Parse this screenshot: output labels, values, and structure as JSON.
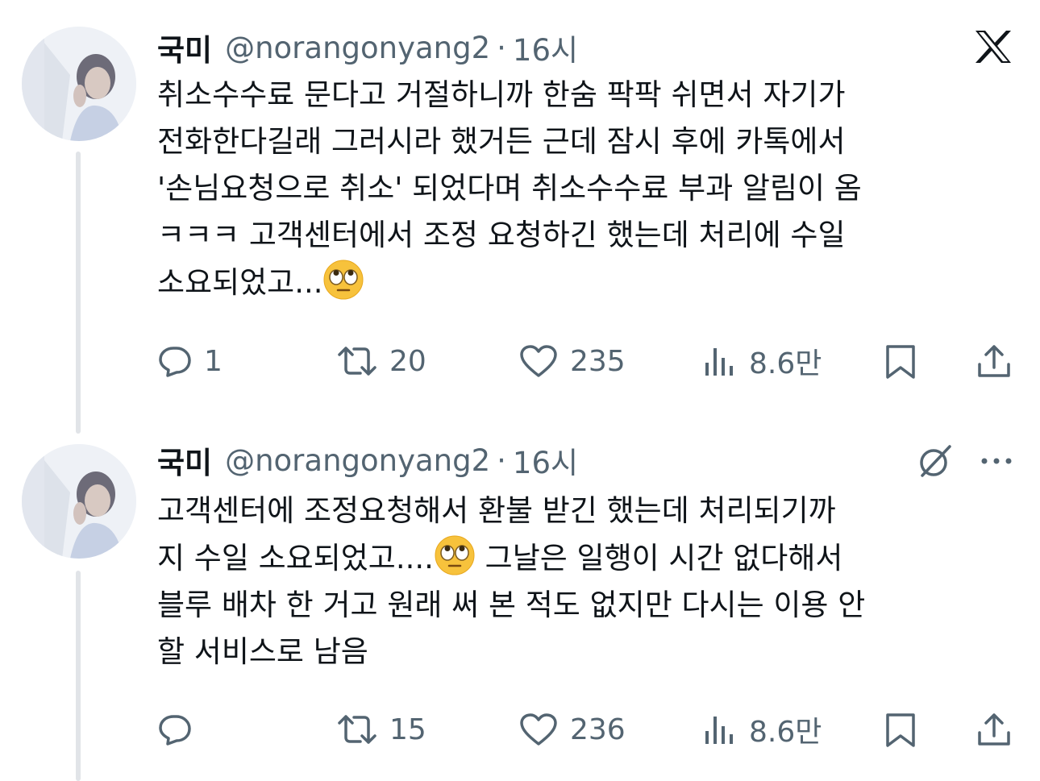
{
  "tweets": [
    {
      "author_name": "국미",
      "handle": "@norangonyang2",
      "separator": "·",
      "time": "16시",
      "text_before_emoji": "취소수수료 문다고 거절하니까 한숨 팍팍 쉬면서 자기가\n전화한다길래 그러시라 했거든 근데 잠시 후에 카톡에서\n'손님요청으로 취소' 되었다며 취소수수료 부과 알림이 옴\nㅋㅋㅋ 고객센터에서 조정 요청하긴 했는데 처리에 수일\n소요되었고...",
      "text_after_emoji": "",
      "emoji_icon": "face-with-rolling-eyes-emoji",
      "replies": "1",
      "reposts": "20",
      "likes": "235",
      "views": "8.6만"
    },
    {
      "author_name": "국미",
      "handle": "@norangonyang2",
      "separator": "·",
      "time": "16시",
      "text_before_emoji": "고객센터에 조정요청해서 환불 받긴 했는데 처리되기까\n지 수일 소요되었고....",
      "text_after_emoji": " 그날은 일행이 시간 없다해서\n블루 배차 한 거고 원래 써 본 적도 없지만 다시는 이용 안\n할 서비스로 남음",
      "emoji_icon": "face-with-rolling-eyes-emoji",
      "replies": "",
      "reposts": "15",
      "likes": "236",
      "views": "8.6만"
    }
  ],
  "icons": {
    "top_right_first": "x-logo-icon",
    "top_right_second": "grok-icon",
    "more": "more-horizontal-icon"
  },
  "colors": {
    "text": "#0f1419",
    "secondary": "#536471",
    "thread_line": "#e1e4e8"
  }
}
